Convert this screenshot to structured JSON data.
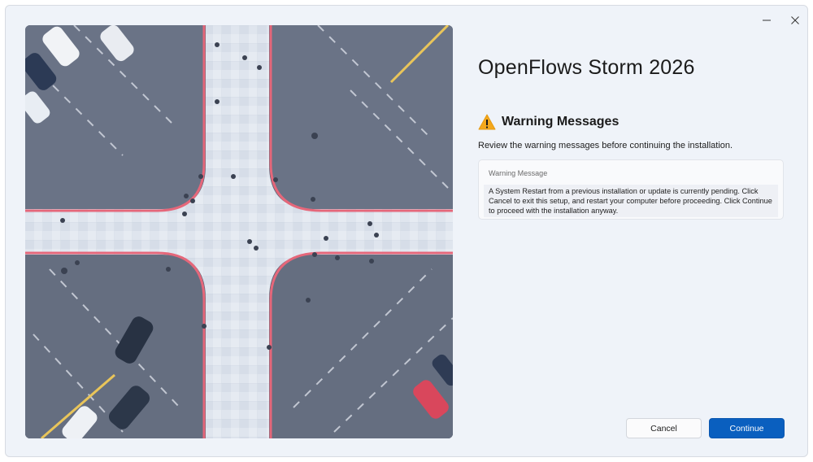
{
  "window": {
    "title": "OpenFlows Storm 2026",
    "controls": {
      "minimize_icon": "minimize-icon",
      "close_icon": "close-icon"
    }
  },
  "hero": {
    "description_icon": "aerial-intersection-image"
  },
  "page": {
    "heading": "Warning Messages",
    "heading_icon": "warning-icon",
    "instruction": "Review the warning messages before continuing the installation."
  },
  "warning_box": {
    "label": "Warning Message",
    "text": "A System Restart from a previous installation or update is currently pending. Click Cancel to exit this setup, and restart your computer before proceeding. Click Continue to proceed with the installation anyway."
  },
  "buttons": {
    "cancel": "Cancel",
    "continue": "Continue"
  },
  "colors": {
    "background": "#eff3f9",
    "accent": "#0a5fbf",
    "warning": "#f4a81c"
  }
}
